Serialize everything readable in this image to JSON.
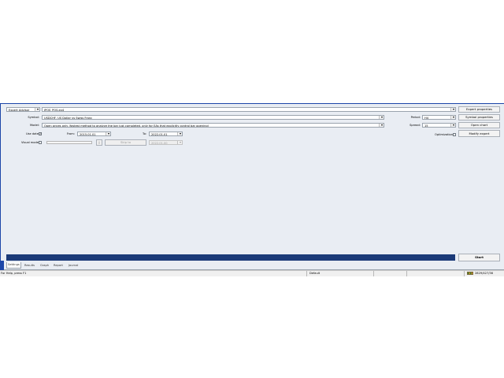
{
  "settings": {
    "expert_type": "Expert Advisor",
    "expert_file": "IPOS_POS.ex4",
    "symbol_label": "Symbol:",
    "symbol_value": "USDCHF, US Dollar vs Swiss Franc",
    "model_label": "Model:",
    "model_value": "Open prices only (fastest method to analyze the bar just completed, only for EAs that explicitly control bar opening)",
    "use_date_label": "Use date",
    "use_date_checked": true,
    "from_label": "From:",
    "from_value": "2015.01.01",
    "to_label": "To:",
    "to_value": "2022.01.01",
    "visual_mode_label": "Visual mode",
    "skip_to_label": "Skip to",
    "skip_to_date": "2022.01.00",
    "pause_label": "||",
    "period_label": "Period:",
    "period_value": "H4",
    "spread_label": "Spread:",
    "spread_value": "15",
    "optimization_label": "Optimization"
  },
  "buttons": {
    "expert_properties": "Expert properties",
    "symbol_properties": "Symbol properties",
    "open_chart": "Open chart",
    "modify_expert": "Modify expert",
    "start": "Start"
  },
  "tabs": [
    "Settings",
    "Results",
    "Graph",
    "Report",
    "Journal"
  ],
  "statusbar": {
    "help": "For Help, press F1",
    "profile": "Default",
    "traffic": "2829/427/36"
  },
  "colors": {
    "progress": "#1b3a78",
    "window_border": "#1c46a8",
    "panel": "#e9edf3"
  }
}
